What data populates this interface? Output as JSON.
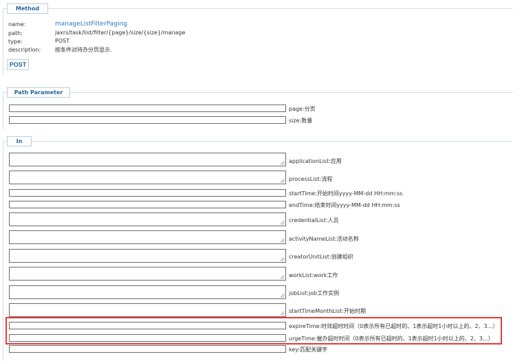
{
  "method": {
    "legend": "Method",
    "rows": [
      {
        "label": "name:",
        "value": "manageListFilterPaging"
      },
      {
        "label": "path:",
        "value": "jaxrs/task/list/filter/{page}/size/{size}/manage"
      },
      {
        "label": "type:",
        "value": "POST"
      },
      {
        "label": "description:",
        "value": "按条件对待办分页显示."
      }
    ],
    "post_button": "POST"
  },
  "path_parameter": {
    "legend": "Path Parameter",
    "params": [
      {
        "label": "page:分页"
      },
      {
        "label": "size:数量"
      }
    ]
  },
  "in": {
    "legend": "In",
    "params": [
      {
        "label": "applicationList:应用"
      },
      {
        "label": "processList:流程"
      },
      {
        "label": "startTime:开始时间yyyy-MM-dd HH:mm:ss"
      },
      {
        "label": "endTime:结束时间yyyy-MM-dd HH:mm:ss"
      },
      {
        "label": "credentialList:人员"
      },
      {
        "label": "activityNameList:活动名称"
      },
      {
        "label": "creatorUnitList:创建组织"
      },
      {
        "label": "workList:work工作"
      },
      {
        "label": "jobList:job工作实例"
      },
      {
        "label": "startTimeMonthList:开始时期"
      },
      {
        "label": "expireTime:时效超时时间（0表示所有已超时的、1表示超时1小时以上的、2、3...）"
      },
      {
        "label": "urgeTime:催办超时时间（0表示所有已超时的、1表示超时1小时以上的、2、3...）"
      },
      {
        "label": "key:匹配关键字"
      }
    ]
  },
  "colors": {
    "accent": "#2a6496",
    "link": "#3377bb",
    "highlight": "#e53935"
  }
}
